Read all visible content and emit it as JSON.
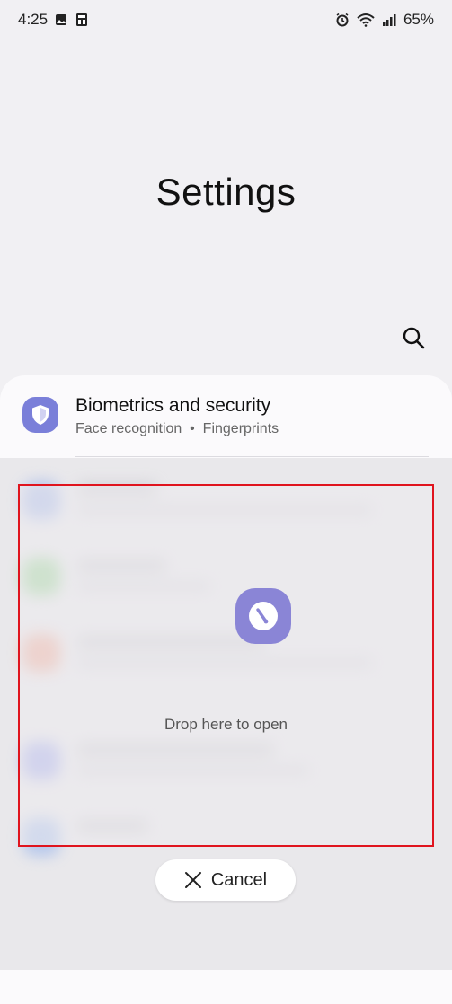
{
  "status_bar": {
    "time": "4:25",
    "battery": "65%",
    "left_icons": [
      "gallery-icon",
      "news-icon"
    ],
    "right_icons": [
      "alarm-icon",
      "wifi-icon",
      "signal-icon"
    ]
  },
  "header": {
    "title": "Settings",
    "search_icon": "search-icon"
  },
  "settings_list": {
    "items": [
      {
        "title": "Biometrics and security",
        "subtitle": "Face recognition  •  Fingerprints",
        "icon": "shield-icon",
        "icon_color": "#7a7fd9"
      }
    ]
  },
  "drop_target": {
    "label": "Drop here to open",
    "app_icon": "digital-wellbeing-icon",
    "border_color": "#e0141e"
  },
  "cancel": {
    "label": "Cancel",
    "icon": "close-icon"
  }
}
